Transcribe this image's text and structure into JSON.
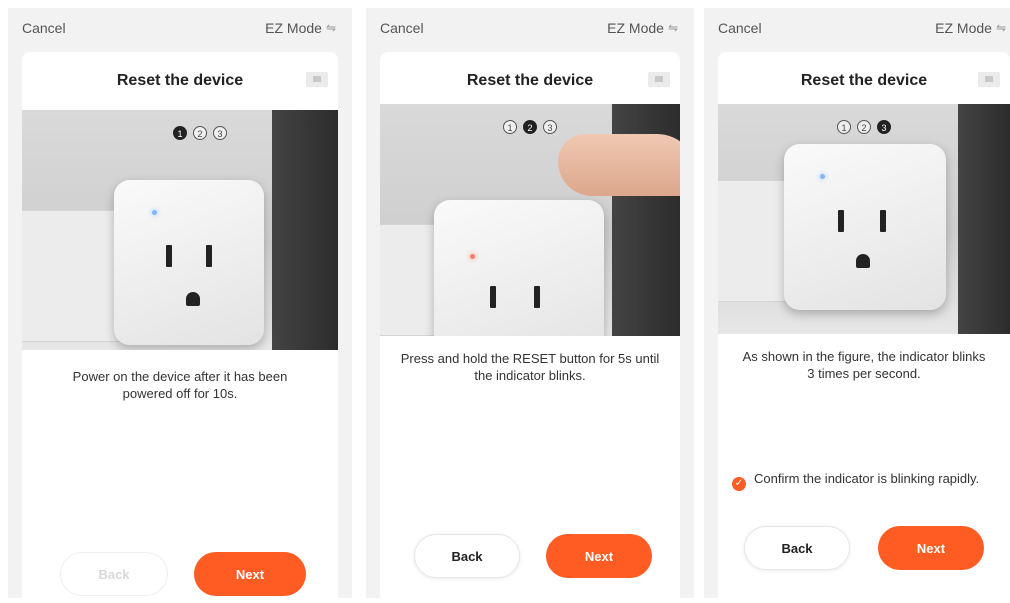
{
  "screens": [
    {
      "cancel": "Cancel",
      "mode": "EZ Mode",
      "title": "Reset the device",
      "steps": [
        "1",
        "2",
        "3"
      ],
      "active_step": 1,
      "description": "Power on the device after it has been powered off for 10s.",
      "back": "Back",
      "back_enabled": false,
      "next": "Next"
    },
    {
      "cancel": "Cancel",
      "mode": "EZ Mode",
      "title": "Reset the device",
      "steps": [
        "1",
        "2",
        "3"
      ],
      "active_step": 2,
      "description": "Press and hold the RESET button for 5s until the indicator blinks.",
      "back": "Back",
      "back_enabled": true,
      "next": "Next"
    },
    {
      "cancel": "Cancel",
      "mode": "EZ Mode",
      "title": "Reset the device",
      "steps": [
        "1",
        "2",
        "3"
      ],
      "active_step": 3,
      "description": "As shown in the figure, the indicator blinks 3 times per second.",
      "confirm": "Confirm the indicator is blinking rapidly.",
      "confirm_checked": true,
      "back": "Back",
      "back_enabled": true,
      "next": "Next"
    }
  ],
  "icons": {
    "mode_switch": "swap-arrows-icon",
    "video": "video-icon",
    "check": "check-circle-icon"
  },
  "colors": {
    "accent": "#ff5c24",
    "background": "#f2f2f2",
    "card": "#ffffff"
  }
}
